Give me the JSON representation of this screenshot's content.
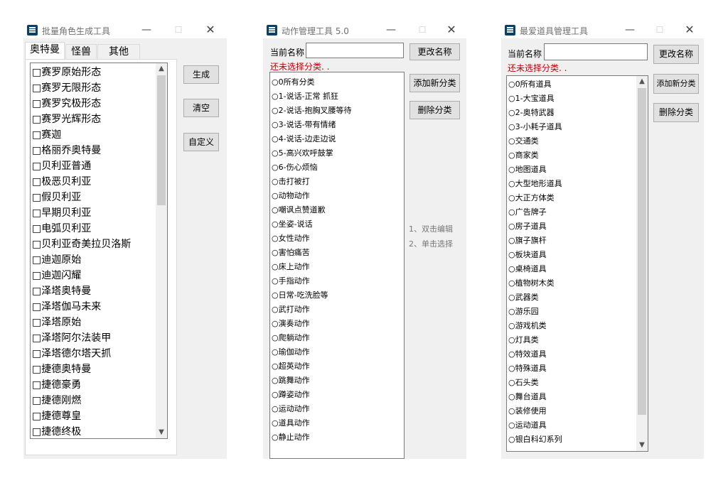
{
  "window1": {
    "title": "批量角色生成工具",
    "tabs": [
      "奥特曼",
      "怪兽",
      "其他"
    ],
    "items": [
      "□赛罗原始形态",
      "□赛罗无限形态",
      "□赛罗究极形态",
      "□赛罗光辉形态",
      "□赛迦",
      "□格丽乔奥特曼",
      "□贝利亚普通",
      "□极恶贝利亚",
      "□假贝利亚",
      "□早期贝利亚",
      "□电弧贝利亚",
      "□贝利亚奇美拉贝洛斯",
      "□迪迦原始",
      "□迪迦闪耀",
      "□泽塔奥特曼",
      "□泽塔伽马未来",
      "□泽塔原始",
      "□泽塔阿尔法装甲",
      "□泽塔德尔塔天抓",
      "□捷德奥特曼",
      "□捷德豪勇",
      "□捷德刚燃",
      "□捷德尊皇",
      "□捷德终极"
    ],
    "buttons": {
      "generate": "生成",
      "clear": "清空",
      "custom": "自定义"
    }
  },
  "window2": {
    "title": "动作管理工具 5.0",
    "name_label": "当前名称",
    "name_value": "",
    "status": "还未选择分类. .",
    "buttons": {
      "rename": "更改名称",
      "add": "添加新分类",
      "delete": "删除分类"
    },
    "items": [
      "○0所有分类",
      "○1-说话-正常 抓狂",
      "○2-说话-抱胸叉腰等待",
      "○3-说话-带有情绪",
      "○4-说话-边走边说",
      "○5-高兴欢呼鼓掌",
      "○6-伤心烦恼",
      "○击打被打",
      "○动物动作",
      "○嘲讽点赞道歉",
      "○坐姿-说话",
      "○女性动作",
      "○害怕痛苦",
      "○床上动作",
      "○手指动作",
      "○日常-吃洗脸等",
      "○武打动作",
      "○演奏动作",
      "○爬躺动作",
      "○瑜伽动作",
      "○超英动作",
      "○跳舞动作",
      "○蹲姿动作",
      "○运动动作",
      "○道具动作",
      "○静止动作"
    ],
    "hints": [
      "1、双击编辑",
      "2、单击选择"
    ]
  },
  "window3": {
    "title": "最爱道具管理工具",
    "name_label": "当前名称",
    "name_value": "",
    "status": "还未选择分类. .",
    "buttons": {
      "rename": "更改名称",
      "add": "添加新分类",
      "delete": "删除分类"
    },
    "items": [
      "○0所有道具",
      "○1-大宝道具",
      "○2-奥特武器",
      "○3-小耗子道具",
      "○交通类",
      "○商家类",
      "○地图道具",
      "○大型地形道具",
      "○大正方体类",
      "○广告牌子",
      "○房子道具",
      "○旗子旗杆",
      "○板块道具",
      "○桌椅道具",
      "○植物树木类",
      "○武器类",
      "○游乐园",
      "○游戏机类",
      "○灯具类",
      "○特效道具",
      "○特殊道具",
      "○石头类",
      "○舞台道具",
      "○装修使用",
      "○运动道具",
      "○银白科幻系列"
    ]
  }
}
